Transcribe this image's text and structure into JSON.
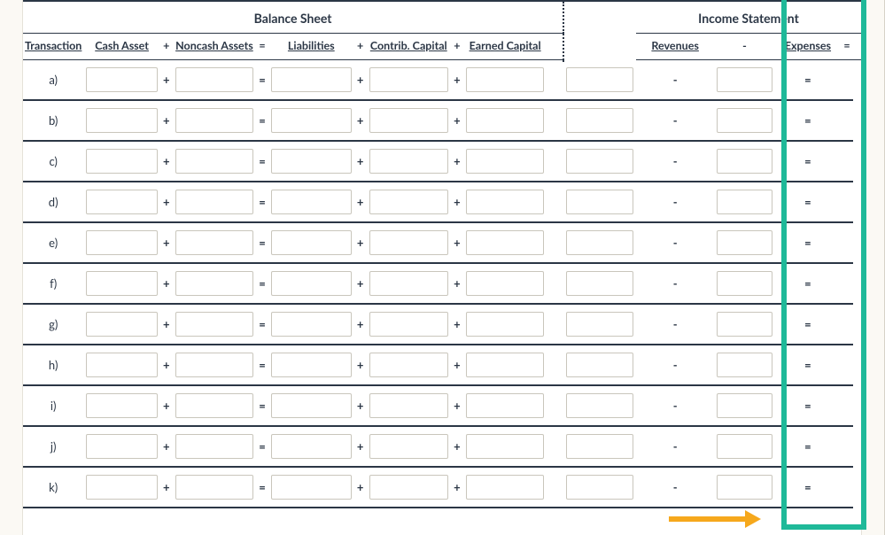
{
  "sections": {
    "balance_sheet": "Balance Sheet",
    "income_statement": "Income Statement"
  },
  "columns": {
    "transaction": "Transaction",
    "cash_asset": "Cash Asset",
    "noncash_assets": "Noncash Assets",
    "liabilities": "Liabilities",
    "contrib_capital": "Contrib. Capital",
    "earned_capital": "Earned Capital",
    "revenues": "Revenues",
    "expenses": "Expenses"
  },
  "ops": {
    "plus": "+",
    "equals": "=",
    "minus": "-"
  },
  "rows": [
    {
      "label": "a)",
      "cash": "",
      "noncash": "",
      "liab": "",
      "contrib": "",
      "earned": "",
      "rev": "",
      "exp": ""
    },
    {
      "label": "b)",
      "cash": "",
      "noncash": "",
      "liab": "",
      "contrib": "",
      "earned": "",
      "rev": "",
      "exp": ""
    },
    {
      "label": "c)",
      "cash": "",
      "noncash": "",
      "liab": "",
      "contrib": "",
      "earned": "",
      "rev": "",
      "exp": ""
    },
    {
      "label": "d)",
      "cash": "",
      "noncash": "",
      "liab": "",
      "contrib": "",
      "earned": "",
      "rev": "",
      "exp": ""
    },
    {
      "label": "e)",
      "cash": "",
      "noncash": "",
      "liab": "",
      "contrib": "",
      "earned": "",
      "rev": "",
      "exp": ""
    },
    {
      "label": "f)",
      "cash": "",
      "noncash": "",
      "liab": "",
      "contrib": "",
      "earned": "",
      "rev": "",
      "exp": ""
    },
    {
      "label": "g)",
      "cash": "",
      "noncash": "",
      "liab": "",
      "contrib": "",
      "earned": "",
      "rev": "",
      "exp": ""
    },
    {
      "label": "h)",
      "cash": "",
      "noncash": "",
      "liab": "",
      "contrib": "",
      "earned": "",
      "rev": "",
      "exp": ""
    },
    {
      "label": "i)",
      "cash": "",
      "noncash": "",
      "liab": "",
      "contrib": "",
      "earned": "",
      "rev": "",
      "exp": ""
    },
    {
      "label": "j)",
      "cash": "",
      "noncash": "",
      "liab": "",
      "contrib": "",
      "earned": "",
      "rev": "",
      "exp": ""
    },
    {
      "label": "k)",
      "cash": "",
      "noncash": "",
      "liab": "",
      "contrib": "",
      "earned": "",
      "rev": "",
      "exp": ""
    }
  ]
}
